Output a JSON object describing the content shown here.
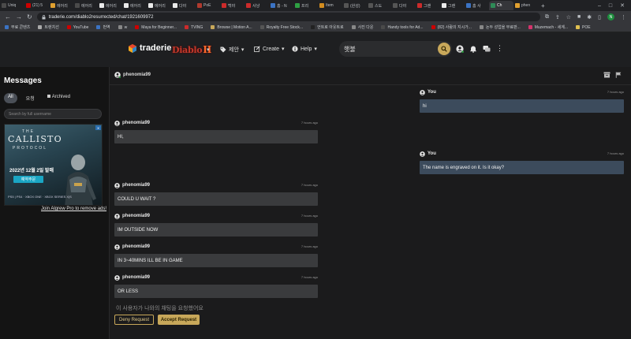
{
  "browser": {
    "tabs": [
      {
        "label": "Uniq",
        "color": "#4b4b4b"
      },
      {
        "label": "(21) 5",
        "color": "#cc0000"
      },
      {
        "label": "에어리",
        "color": "#e0a030"
      },
      {
        "label": "에어리",
        "color": "#4a4a4a"
      },
      {
        "label": "에어리",
        "color": "#eaeaea"
      },
      {
        "label": "에어리",
        "color": "#eaeaea"
      },
      {
        "label": "에어리",
        "color": "#eaeaea"
      },
      {
        "label": "다야",
        "color": "#eaeaea"
      },
      {
        "label": "PoE",
        "color": "#b03a2e"
      },
      {
        "label": "백야",
        "color": "#cc2b2b"
      },
      {
        "label": "사냥",
        "color": "#cc2b2b"
      },
      {
        "label": "홈 - N",
        "color": "#3b73c4"
      },
      {
        "label": "프리",
        "color": "#2ea043"
      },
      {
        "label": "Item",
        "color": "#d28c1f"
      },
      {
        "label": "(완성)",
        "color": "#555555"
      },
      {
        "label": "스도",
        "color": "#555555"
      },
      {
        "label": "다야",
        "color": "#555555"
      },
      {
        "label": "그랜",
        "color": "#cc2b2b"
      },
      {
        "label": "그랜",
        "color": "#eaeaea"
      },
      {
        "label": "홈 사",
        "color": "#3b73c4"
      },
      {
        "label": "Ch",
        "color": "#2e8b57",
        "active": true
      },
      {
        "label": "phen",
        "color": "#e0a030"
      }
    ],
    "new_tab": "+",
    "window_controls": [
      "–",
      "□",
      "✕"
    ],
    "url": "traderie.com/diablo2resurrected/chat/1921609972",
    "profile_initial": "N",
    "bookmarks": [
      {
        "label": "무료 콘텐츠",
        "color": "#3b73c4"
      },
      {
        "label": "트렌치선",
        "color": "#aaaaaa"
      },
      {
        "label": "YouTube",
        "color": "#cc0000"
      },
      {
        "label": "번역",
        "color": "#3b73c4"
      },
      {
        "label": "w",
        "color": "#888888"
      },
      {
        "label": "Maya for Beginner...",
        "color": "#cc0000"
      },
      {
        "label": "TVING",
        "color": "#cc2b2b"
      },
      {
        "label": "Browse | Motion A...",
        "color": "#c8a85a"
      },
      {
        "label": "Royalty Free Stock...",
        "color": "#555555"
      },
      {
        "label": "언트로 아웃트로",
        "color": "#222222"
      },
      {
        "label": "사진 다운",
        "color": "#888888"
      },
      {
        "label": "Handy tools for Ad...",
        "color": "#4a4a4a"
      },
      {
        "label": "(82) 사람의 지시가...",
        "color": "#cc0000"
      },
      {
        "label": "논두 성업을 무료판...",
        "color": "#888888"
      },
      {
        "label": "Muzemach - 세계...",
        "color": "#d6336c"
      },
      {
        "label": "POE",
        "color": "#e0c050"
      }
    ]
  },
  "site": {
    "logo": "traderie",
    "game_logo_text": "Diablo",
    "game_logo_roman": "II",
    "nav": [
      {
        "label": "제안",
        "icon": "tag-icon"
      },
      {
        "label": "Create",
        "icon": "edit-icon"
      },
      {
        "label": "Help",
        "icon": "info-icon"
      }
    ],
    "search_value": "햇불"
  },
  "sidebar": {
    "title": "Messages",
    "filters": [
      {
        "label": "All",
        "active": true
      },
      {
        "label": "요청",
        "active": false
      },
      {
        "label": "Archived",
        "active": false
      }
    ],
    "search_placeholder": "Search by full username",
    "ad": {
      "the": "THE",
      "title": "CALLISTO",
      "subtitle": "PROTOCOL",
      "date": "2022년 12월 2일 발매",
      "button": "예약주문",
      "platforms": "PS5 | PS4 · XBOX ONE · XBOX SERIES X|S",
      "close": "✕"
    },
    "pro_link": "Join Algrew Pro to remove ads!"
  },
  "chat": {
    "partner": "phenomia99",
    "messages": [
      {
        "side": "me",
        "user": "You",
        "time": "7 hours ago",
        "text": "hi"
      },
      {
        "side": "them",
        "user": "phenomia99",
        "time": "7 hours ago",
        "text": "HI,"
      },
      {
        "side": "me",
        "user": "You",
        "time": "7 hours ago",
        "text": "The name is engraved on it. Is it okay?"
      },
      {
        "side": "them",
        "user": "phenomia99",
        "time": "7 hours ago",
        "text": "COULD U WAIT ?"
      },
      {
        "side": "them",
        "user": "phenomia99",
        "time": "7 hours ago",
        "text": "IM OUTSIDE NOW"
      },
      {
        "side": "them",
        "user": "phenomia99",
        "time": "7 hours ago",
        "text": "IN 3~40MINS ILL BE IN GAME"
      },
      {
        "side": "them",
        "user": "phenomia99",
        "time": "7 hours ago",
        "text": "OR LESS"
      }
    ],
    "request_text": "이 사용자가 나와의 채팅을 요청했어요",
    "deny_label": "Deny Request",
    "accept_label": "Accept Request"
  },
  "colors": {
    "accent": "#c8a85a",
    "my_bubble": "#3c4b5c",
    "their_bubble": "#3a3b3d",
    "online": "#2ea043"
  }
}
